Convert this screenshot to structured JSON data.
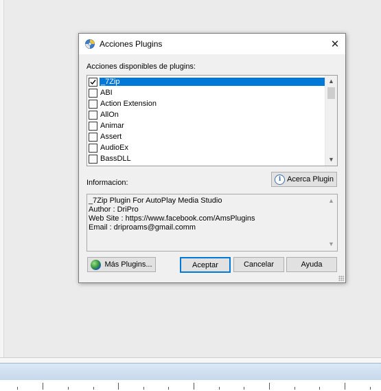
{
  "dialog": {
    "title": "Acciones Plugins",
    "close_glyph": "✕",
    "list_label": "Acciones disponibles de plugins:",
    "plugins": [
      {
        "label": "_7Zip",
        "checked": true,
        "selected": true
      },
      {
        "label": "ABI",
        "checked": false,
        "selected": false
      },
      {
        "label": "Action Extension",
        "checked": false,
        "selected": false
      },
      {
        "label": "AllOn",
        "checked": false,
        "selected": false
      },
      {
        "label": "Animar",
        "checked": false,
        "selected": false
      },
      {
        "label": "Assert",
        "checked": false,
        "selected": false
      },
      {
        "label": "AudioEx",
        "checked": false,
        "selected": false
      },
      {
        "label": "BassDLL",
        "checked": false,
        "selected": false
      }
    ],
    "info_label": "Informacion:",
    "about_button": "Acerca Plugin",
    "info_lines": [
      "_7Zip Plugin For AutoPlay Media Studio",
      "Author : DriPro",
      "Web Site : https://www.facebook.com/AmsPlugins",
      "Email : driproams@gmail.comm"
    ],
    "more_plugins_button": "Más Plugins...",
    "accept_button": "Aceptar",
    "cancel_button": "Cancelar",
    "help_button": "Ayuda"
  },
  "icons": {
    "app_icon": "cd-disc-icon",
    "info_icon": "info-icon",
    "globe_icon": "globe-icon",
    "scroll_up": "▲",
    "scroll_down": "▼"
  },
  "colors": {
    "selection": "#0078d7",
    "default_button_border": "#0078d7"
  }
}
